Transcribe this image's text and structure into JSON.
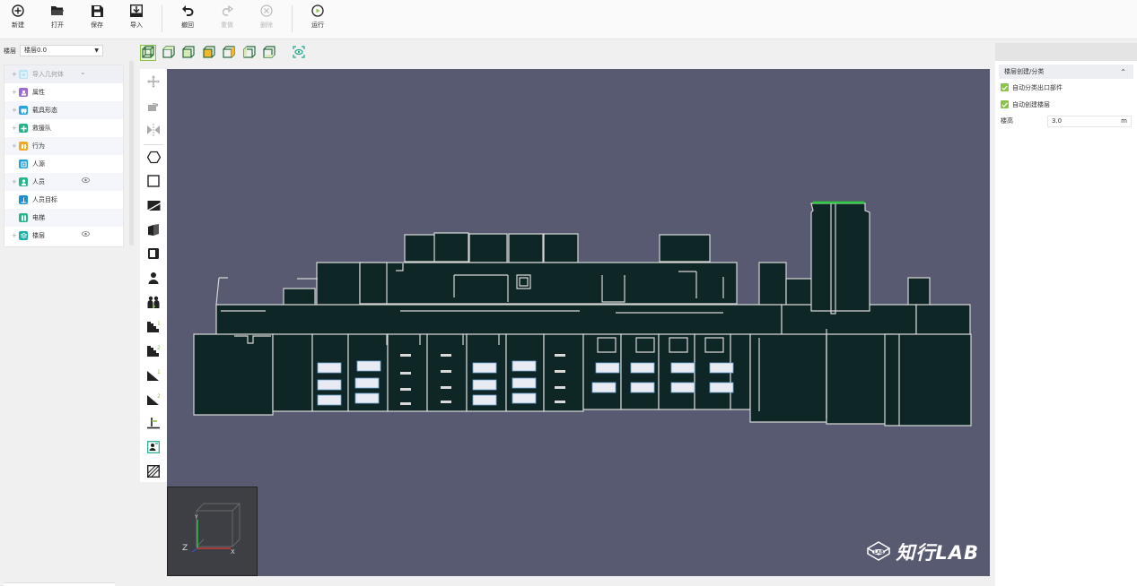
{
  "toolbar": {
    "new_label": "新建",
    "open_label": "打开",
    "save_label": "保存",
    "import_label": "导入",
    "undo_label": "撤回",
    "redo_label": "重做",
    "delete_label": "删除",
    "run_label": "运行"
  },
  "floor": {
    "label": "楼层",
    "selected": "楼层0.0"
  },
  "tree": {
    "items": [
      {
        "label": "导入几何体",
        "icon": "import-geometry-icon",
        "color": "#7ec8e3"
      },
      {
        "label": "属性",
        "icon": "property-icon",
        "color": "#9b6bd6"
      },
      {
        "label": "载具形态",
        "icon": "vehicle-icon",
        "color": "#29a3e0"
      },
      {
        "label": "救援队",
        "icon": "rescue-team-icon",
        "color": "#26b58a"
      },
      {
        "label": "行为",
        "icon": "behavior-icon",
        "color": "#f5a623"
      },
      {
        "label": "人源",
        "icon": "person-source-icon",
        "color": "#1fa0d8"
      },
      {
        "label": "人员",
        "icon": "person-icon",
        "color": "#26b58a"
      },
      {
        "label": "人员目标",
        "icon": "person-target-icon",
        "color": "#1b8fd6"
      },
      {
        "label": "电梯",
        "icon": "elevator-icon",
        "color": "#26b58a"
      },
      {
        "label": "楼层",
        "icon": "floor-icon",
        "color": "#1ab0a8"
      }
    ]
  },
  "right_panel": {
    "section_title": "楼层创建/分类",
    "check_auto_exit": "自动分类出口部件",
    "check_auto_floor": "自动创建楼层",
    "height_label": "楼高",
    "height_value": "3.0",
    "height_unit": "m"
  },
  "viewport": {
    "logo_text": "知行LAB",
    "axis_y": "Y",
    "axis_x": "X",
    "axis_z": "Z",
    "background": "#575a70",
    "plan_color": "#0f2626"
  },
  "colors": {
    "accent": "#8bc34a",
    "highlight": "#2ecc40"
  }
}
